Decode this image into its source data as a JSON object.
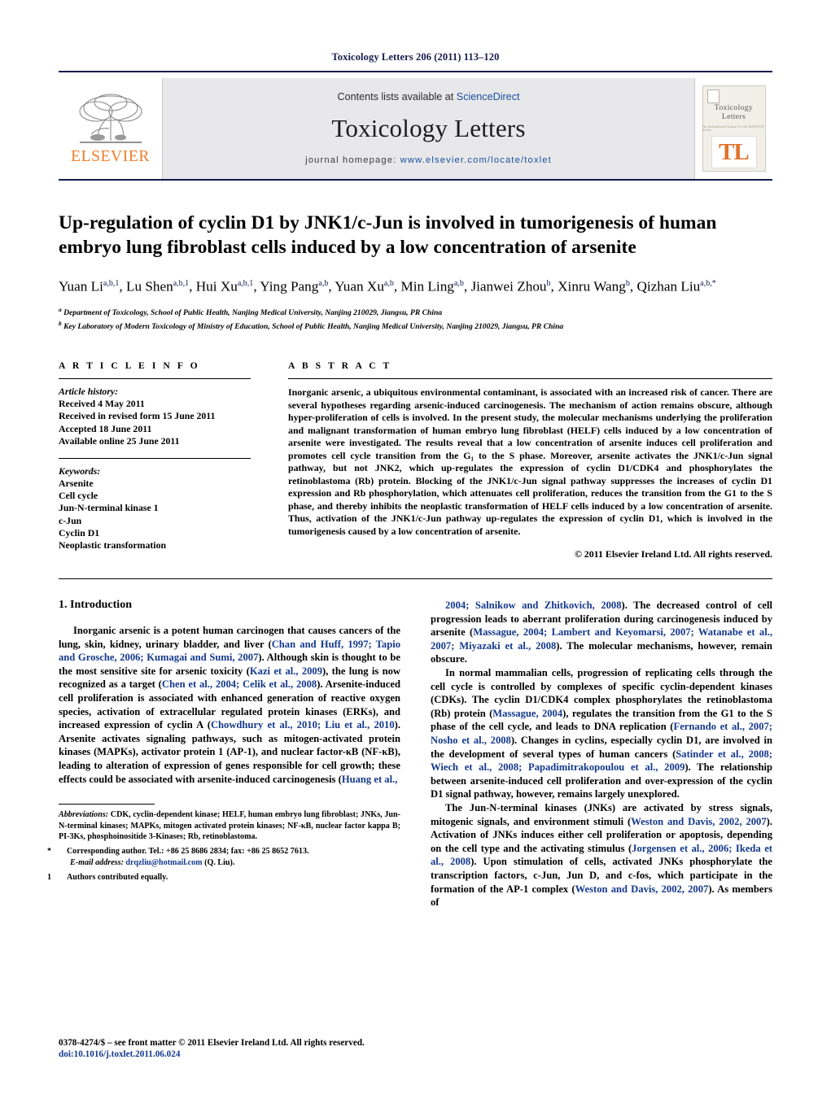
{
  "running_head": "Toxicology Letters 206 (2011) 113–120",
  "banner": {
    "publisher_name": "ELSEVIER",
    "contents_prefix": "Contents lists available at ",
    "sciencedirect": "ScienceDirect",
    "journal_title": "Toxicology Letters",
    "homepage_prefix": "journal homepage: ",
    "homepage_url": "www.elsevier.com/locate/toxlet",
    "cover_title": "Toxicology\nLetters",
    "cover_subtitle": "An International Journal for the EUROTOX Series",
    "cover_monogram": "TL"
  },
  "article": {
    "title": "Up-regulation of cyclin D1 by JNK1/c-Jun is involved in tumorigenesis of human embryo lung fibroblast cells induced by a low concentration of arsenite",
    "authors_html": "Yuan Li<sup>a,b,1</sup>, Lu Shen<sup>a,b,1</sup>, Hui Xu<sup>a,b,1</sup>, Ying Pang<sup>a,b</sup>, Yuan Xu<sup>a,b</sup>, Min Ling<sup>a,b</sup>, Jianwei Zhou<sup>b</sup>, Xinru Wang<sup>b</sup>, Qizhan Liu<sup>a,b,</sup><sup>*</sup>",
    "affiliations": [
      "Department of Toxicology, School of Public Health, Nanjing Medical University, Nanjing 210029, Jiangsu, PR China",
      "Key Laboratory of Modern Toxicology of Ministry of Education, School of Public Health, Nanjing Medical University, Nanjing 210029, Jiangsu, PR China"
    ],
    "affiliation_marks": [
      "a",
      "b"
    ]
  },
  "article_info": {
    "heading": "A R T I C L E    I N F O",
    "history_label": "Article history:",
    "history": [
      "Received 4 May 2011",
      "Received in revised form 15 June 2011",
      "Accepted 18 June 2011",
      "Available online 25 June 2011"
    ],
    "keywords_label": "Keywords:",
    "keywords": [
      "Arsenite",
      "Cell cycle",
      "Jun-N-terminal kinase 1",
      "c-Jun",
      "Cyclin D1",
      "Neoplastic transformation"
    ]
  },
  "abstract": {
    "heading": "A B S T R A C T",
    "text": "Inorganic arsenic, a ubiquitous environmental contaminant, is associated with an increased risk of cancer. There are several hypotheses regarding arsenic-induced carcinogenesis. The mechanism of action remains obscure, although hyper-proliferation of cells is involved. In the present study, the molecular mechanisms underlying the proliferation and malignant transformation of human embryo lung fibroblast (HELF) cells induced by a low concentration of arsenite were investigated. The results reveal that a low concentration of arsenite induces cell proliferation and promotes cell cycle transition from the G₁ to the S phase. Moreover, arsenite activates the JNK1/c-Jun signal pathway, but not JNK2, which up-regulates the expression of cyclin D1/CDK4 and phosphorylates the retinoblastoma (Rb) protein. Blocking of the JNK1/c-Jun signal pathway suppresses the increases of cyclin D1 expression and Rb phosphorylation, which attenuates cell proliferation, reduces the transition from the G1 to the S phase, and thereby inhibits the neoplastic transformation of HELF cells induced by a low concentration of arsenite. Thus, activation of the JNK1/c-Jun pathway up-regulates the expression of cyclin D1, which is involved in the tumorigenesis caused by a low concentration of arsenite.",
    "copyright": "© 2011 Elsevier Ireland Ltd. All rights reserved."
  },
  "introduction": {
    "heading": "1.  Introduction",
    "left_paragraph_html": "Inorganic arsenic is a potent human carcinogen that causes cancers of the lung, skin, kidney, urinary bladder, and liver (<span class=\"cite\">Chan and Huff, 1997; Tapio and Grosche, 2006; Kumagai and Sumi, 2007</span>). Although skin is thought to be the most sensitive site for arsenic toxicity (<span class=\"cite\">Kazi et al., 2009</span>), the lung is now recognized as a target (<span class=\"cite\">Chen et al., 2004; Celik et al., 2008</span>). Arsenite-induced cell proliferation is associated with enhanced generation of reactive oxygen species, activation of extracellular regulated protein kinases (ERKs), and increased expression of cyclin A (<span class=\"cite\">Chowdhury et al., 2010; Liu et al., 2010</span>). Arsenite activates signaling pathways, such as mitogen-activated protein kinases (MAPKs), activator protein 1 (AP-1), and nuclear factor-κB (NF-κB), leading to alteration of expression of genes responsible for cell growth; these effects could be associated with arsenite-induced carcinogenesis (<span class=\"cite\">Huang et al.,</span>",
    "right_paragraphs_html": [
      "<span class=\"cite\">2004; Salnikow and Zhitkovich, 2008</span>). The decreased control of cell progression leads to aberrant proliferation during carcinogenesis induced by arsenite (<span class=\"cite\">Massague, 2004; Lambert and Keyomarsi, 2007; Watanabe et al., 2007; Miyazaki et al., 2008</span>). The molecular mechanisms, however, remain obscure.",
      "In normal mammalian cells, progression of replicating cells through the cell cycle is controlled by complexes of specific cyclin-dependent kinases (CDKs). The cyclin D1/CDK4 complex phosphorylates the retinoblastoma (Rb) protein (<span class=\"cite\">Massague, 2004</span>), regulates the transition from the G1 to the S phase of the cell cycle, and leads to DNA replication (<span class=\"cite\">Fernando et al., 2007; Nosho et al., 2008</span>). Changes in cyclins, especially cyclin D1, are involved in the development of several types of human cancers (<span class=\"cite\">Satinder et al., 2008; Wiech et al., 2008; Papadimitrakopoulou et al., 2009</span>). The relationship between arsenite-induced cell proliferation and over-expression of the cyclin D1 signal pathway, however, remains largely unexplored.",
      "The Jun-N-terminal kinases (JNKs) are activated by stress signals, mitogenic signals, and environment stimuli (<span class=\"cite\">Weston and Davis, 2002, 2007</span>). Activation of JNKs induces either cell proliferation or apoptosis, depending on the cell type and the activating stimulus (<span class=\"cite\">Jorgensen et al., 2006; Ikeda et al., 2008</span>). Upon stimulation of cells, activated JNKs phosphorylate the transcription factors, c-Jun, Jun D, and c-fos, which participate in the formation of the AP-1 complex (<span class=\"cite\">Weston and Davis, 2002, 2007</span>). As members of"
    ]
  },
  "footnotes": {
    "abbreviations_label": "Abbreviations:",
    "abbreviations_text": "  CDK, cyclin-dependent kinase; HELF, human embryo lung fibroblast; JNKs, Jun-N-terminal kinases; MAPKs, mitogen activated protein kinases; NF-κB, nuclear factor kappa B; PI-3Ks, phosphoinositide 3-Kinases; Rb, retinoblastoma.",
    "corresponding_mark": "*",
    "corresponding_text": "Corresponding author. Tel.: +86 25 8686 2834; fax: +86 25 8652 7613.",
    "email_label": "E-mail address:",
    "email": "drqzliu@hotmail.com",
    "email_suffix": " (Q. Liu).",
    "equal_mark": "1",
    "equal_text": "Authors contributed equally."
  },
  "footer": {
    "issn_line": "0378-4274/$ – see front matter © 2011 Elsevier Ireland Ltd. All rights reserved.",
    "doi": "doi:10.1016/j.toxlet.2011.06.024"
  }
}
